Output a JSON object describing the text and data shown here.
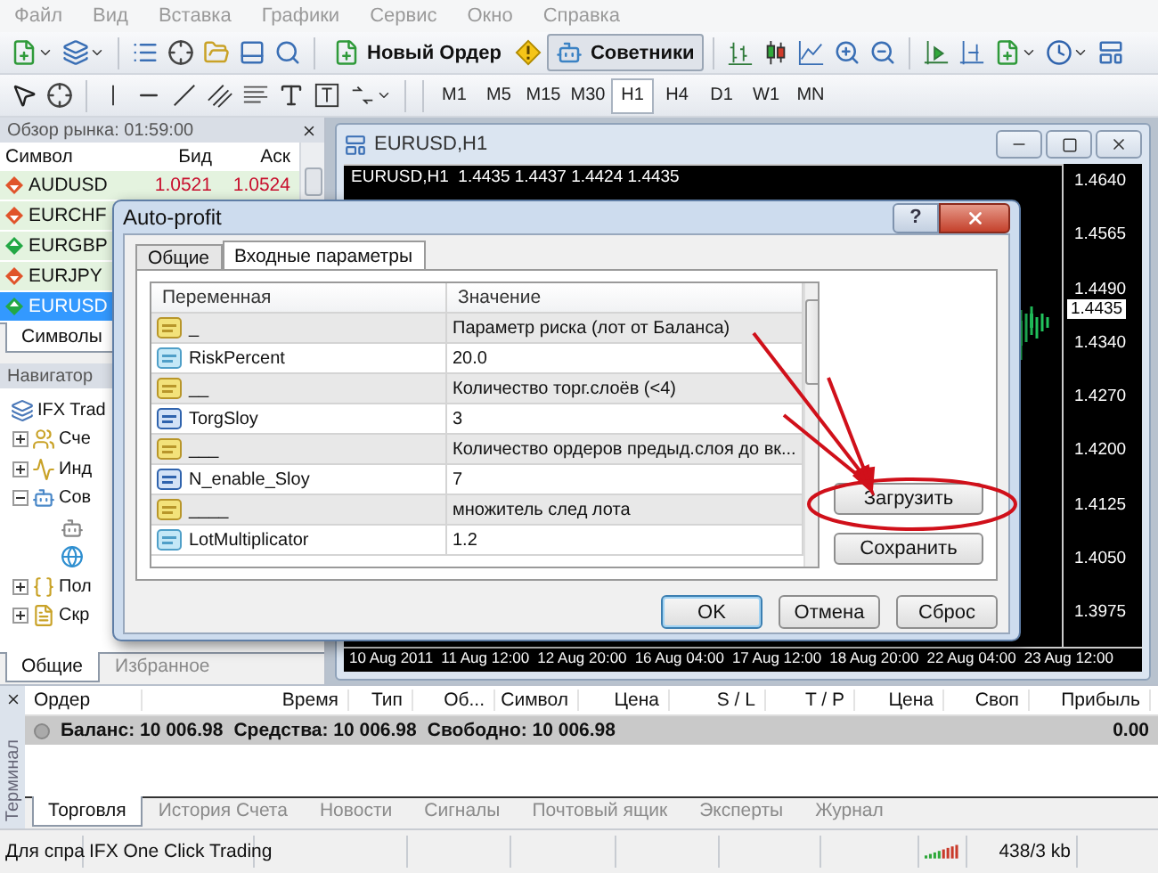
{
  "menu": [
    "Файл",
    "Вид",
    "Вставка",
    "Графики",
    "Сервис",
    "Окно",
    "Справка"
  ],
  "toolbar": {
    "buttons": [
      {
        "kind": "order",
        "label": "Новый Ордер",
        "pressed": false
      },
      {
        "kind": "experts",
        "label": "Советники",
        "pressed": true
      }
    ]
  },
  "timeframes": [
    {
      "label": "M1",
      "selected": false
    },
    {
      "label": "M5",
      "selected": false
    },
    {
      "label": "M15",
      "selected": false
    },
    {
      "label": "M30",
      "selected": false
    },
    {
      "label": "H1",
      "selected": true
    },
    {
      "label": "H4",
      "selected": false
    },
    {
      "label": "D1",
      "selected": false
    },
    {
      "label": "W1",
      "selected": false
    },
    {
      "label": "MN",
      "selected": false
    }
  ],
  "market_watch": {
    "title": "Обзор рынка: 01:59:00",
    "columns": [
      "Символ",
      "Бид",
      "Аск"
    ],
    "rows": [
      {
        "symbol": "AUDUSD",
        "rising": false,
        "bid": "1.0521",
        "ask": "1.0524",
        "selected": false
      },
      {
        "symbol": "EURCHF",
        "rising": false,
        "selected": false
      },
      {
        "symbol": "EURGBP",
        "rising": true,
        "selected": false
      },
      {
        "symbol": "EURJPY",
        "rising": false,
        "selected": false
      },
      {
        "symbol": "EURUSD",
        "rising": true,
        "selected": true
      }
    ],
    "tabs": [
      {
        "label": "Символы",
        "selected": true
      }
    ]
  },
  "navigator": {
    "title": "Навигатор",
    "root": {
      "kind": "root",
      "label": "IFX Trad",
      "children": [
        {
          "kind": "accounts",
          "label": "Сче",
          "expanded": false
        },
        {
          "kind": "indicators",
          "label": "Инд",
          "expanded": false
        },
        {
          "kind": "experts",
          "label": "Сов",
          "expanded": true,
          "children": [
            {
              "kind": "expert"
            },
            {
              "kind": "globe"
            }
          ]
        },
        {
          "kind": "functions",
          "label": "Пол",
          "expanded": false
        },
        {
          "kind": "scripts",
          "label": "Скр",
          "expanded": false
        }
      ]
    },
    "tabs": [
      {
        "label": "Общие",
        "selected": true
      },
      {
        "label": "Избранное",
        "selected": false
      }
    ]
  },
  "chart": {
    "title": "EURUSD,H1",
    "info": "EURUSD,H1  1.4435 1.4437 1.4424 1.4435",
    "prices": [
      "1.4640",
      "1.4565",
      "1.4490",
      "1.4340",
      "1.4270",
      "1.4200",
      "1.4125",
      "1.4050",
      "1.3975"
    ],
    "current_price": "1.4435",
    "dates": [
      "10 Aug 2011",
      "11 Aug 12:00",
      "12 Aug 20:00",
      "16 Aug 04:00",
      "17 Aug 12:00",
      "18 Aug 20:00",
      "22 Aug 04:00",
      "23 Aug 12:00"
    ]
  },
  "dialog": {
    "title": "Auto-profit",
    "help": "?",
    "tabs": [
      {
        "label": "Общие",
        "selected": false
      },
      {
        "label": "Входные параметры",
        "selected": true
      }
    ],
    "columns": [
      "Переменная",
      "Значение"
    ],
    "rows": [
      {
        "kind": "string",
        "name": "_",
        "value": "Параметр риска (лот от Баланса)"
      },
      {
        "kind": "double",
        "name": "RiskPercent",
        "value": "20.0"
      },
      {
        "kind": "string",
        "name": "__",
        "value": "Количество торг.слоёв (<4)"
      },
      {
        "kind": "integer",
        "name": "TorgSloy",
        "value": "3"
      },
      {
        "kind": "string",
        "name": "___",
        "value": "Количество ордеров предыд.слоя до вк..."
      },
      {
        "kind": "integer",
        "name": "N_enable_Sloy",
        "value": "7"
      },
      {
        "kind": "string",
        "name": "____",
        "value": "множитель след лота"
      },
      {
        "kind": "double",
        "name": "LotMultiplicator",
        "value": "1.2"
      }
    ],
    "side_buttons": [
      "Загрузить",
      "Сохранить"
    ],
    "buttons": [
      {
        "label": "OK",
        "default": true
      },
      {
        "label": "Отмена",
        "default": false
      },
      {
        "label": "Сброс",
        "default": false
      }
    ]
  },
  "terminal": {
    "label": "Терминал",
    "columns": [
      "Ордер",
      "Время",
      "Тип",
      "Об...",
      "Символ",
      "Цена",
      "S / L",
      "T / P",
      "Цена",
      "Своп",
      "Прибыль"
    ],
    "summary": [
      "Баланс: 10 006.98",
      "Средства: 10 006.98",
      "Свободно: 10 006.98"
    ],
    "profit": "0.00",
    "tabs": [
      {
        "label": "Торговля",
        "selected": true
      },
      {
        "label": "История Счета",
        "selected": false
      },
      {
        "label": "Новости",
        "selected": false
      },
      {
        "label": "Сигналы",
        "selected": false
      },
      {
        "label": "Почтовый ящик",
        "selected": false
      },
      {
        "label": "Эксперты",
        "selected": false
      },
      {
        "label": "Журнал",
        "selected": false
      }
    ]
  },
  "status_bar": {
    "cells": [
      "Для спра",
      "IFX One Click Trading"
    ],
    "traffic": "438/3 kb"
  }
}
